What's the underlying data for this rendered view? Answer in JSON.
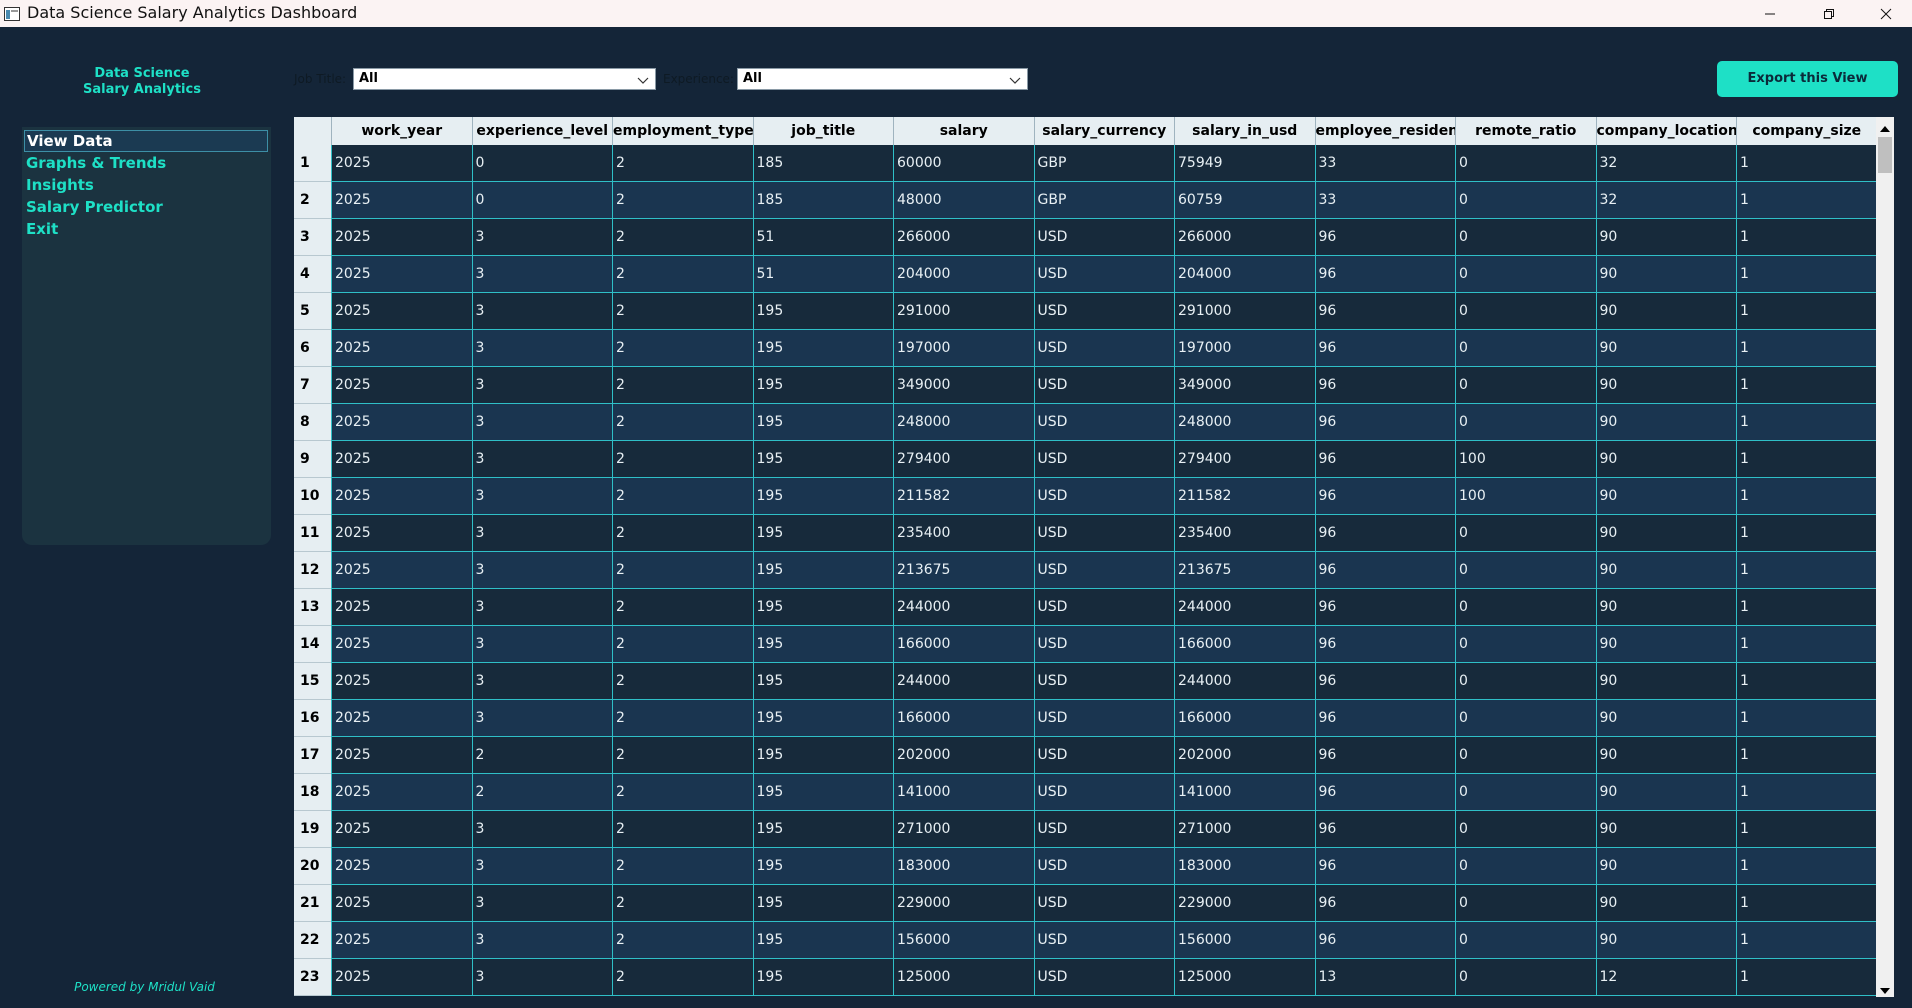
{
  "window": {
    "title": "Data Science Salary Analytics Dashboard"
  },
  "sidebar": {
    "brand_line1": "Data Science",
    "brand_line2": "Salary Analytics",
    "items": [
      {
        "label": "View Data",
        "active": true
      },
      {
        "label": "Graphs & Trends",
        "active": false
      },
      {
        "label": "Insights",
        "active": false
      },
      {
        "label": "Salary Predictor",
        "active": false
      },
      {
        "label": "Exit",
        "active": false
      }
    ],
    "footer": "Powered by Mridul Vaid"
  },
  "filters": {
    "job_title_label": "Job Title:",
    "job_title_value": "All",
    "experience_label": "Experience:",
    "experience_value": "All"
  },
  "toolbar": {
    "export_label": "Export this View"
  },
  "table": {
    "columns": [
      "work_year",
      "experience_level",
      "employment_type",
      "job_title",
      "salary",
      "salary_currency",
      "salary_in_usd",
      "employee_residence",
      "remote_ratio",
      "company_location",
      "company_size"
    ],
    "row_numbers": [
      "1",
      "2",
      "3",
      "4",
      "5",
      "6",
      "7",
      "8",
      "9",
      "10",
      "11",
      "12",
      "13",
      "14",
      "15",
      "16",
      "17",
      "18",
      "19",
      "20",
      "21",
      "22",
      "23"
    ],
    "rows": [
      [
        "2025",
        "0",
        "2",
        "185",
        "60000",
        "GBP",
        "75949",
        "33",
        "0",
        "32",
        "1"
      ],
      [
        "2025",
        "0",
        "2",
        "185",
        "48000",
        "GBP",
        "60759",
        "33",
        "0",
        "32",
        "1"
      ],
      [
        "2025",
        "3",
        "2",
        "51",
        "266000",
        "USD",
        "266000",
        "96",
        "0",
        "90",
        "1"
      ],
      [
        "2025",
        "3",
        "2",
        "51",
        "204000",
        "USD",
        "204000",
        "96",
        "0",
        "90",
        "1"
      ],
      [
        "2025",
        "3",
        "2",
        "195",
        "291000",
        "USD",
        "291000",
        "96",
        "0",
        "90",
        "1"
      ],
      [
        "2025",
        "3",
        "2",
        "195",
        "197000",
        "USD",
        "197000",
        "96",
        "0",
        "90",
        "1"
      ],
      [
        "2025",
        "3",
        "2",
        "195",
        "349000",
        "USD",
        "349000",
        "96",
        "0",
        "90",
        "1"
      ],
      [
        "2025",
        "3",
        "2",
        "195",
        "248000",
        "USD",
        "248000",
        "96",
        "0",
        "90",
        "1"
      ],
      [
        "2025",
        "3",
        "2",
        "195",
        "279400",
        "USD",
        "279400",
        "96",
        "100",
        "90",
        "1"
      ],
      [
        "2025",
        "3",
        "2",
        "195",
        "211582",
        "USD",
        "211582",
        "96",
        "100",
        "90",
        "1"
      ],
      [
        "2025",
        "3",
        "2",
        "195",
        "235400",
        "USD",
        "235400",
        "96",
        "0",
        "90",
        "1"
      ],
      [
        "2025",
        "3",
        "2",
        "195",
        "213675",
        "USD",
        "213675",
        "96",
        "0",
        "90",
        "1"
      ],
      [
        "2025",
        "3",
        "2",
        "195",
        "244000",
        "USD",
        "244000",
        "96",
        "0",
        "90",
        "1"
      ],
      [
        "2025",
        "3",
        "2",
        "195",
        "166000",
        "USD",
        "166000",
        "96",
        "0",
        "90",
        "1"
      ],
      [
        "2025",
        "3",
        "2",
        "195",
        "244000",
        "USD",
        "244000",
        "96",
        "0",
        "90",
        "1"
      ],
      [
        "2025",
        "3",
        "2",
        "195",
        "166000",
        "USD",
        "166000",
        "96",
        "0",
        "90",
        "1"
      ],
      [
        "2025",
        "2",
        "2",
        "195",
        "202000",
        "USD",
        "202000",
        "96",
        "0",
        "90",
        "1"
      ],
      [
        "2025",
        "2",
        "2",
        "195",
        "141000",
        "USD",
        "141000",
        "96",
        "0",
        "90",
        "1"
      ],
      [
        "2025",
        "3",
        "2",
        "195",
        "271000",
        "USD",
        "271000",
        "96",
        "0",
        "90",
        "1"
      ],
      [
        "2025",
        "3",
        "2",
        "195",
        "183000",
        "USD",
        "183000",
        "96",
        "0",
        "90",
        "1"
      ],
      [
        "2025",
        "3",
        "2",
        "195",
        "229000",
        "USD",
        "229000",
        "96",
        "0",
        "90",
        "1"
      ],
      [
        "2025",
        "3",
        "2",
        "195",
        "156000",
        "USD",
        "156000",
        "96",
        "0",
        "90",
        "1"
      ],
      [
        "2025",
        "3",
        "2",
        "195",
        "125000",
        "USD",
        "125000",
        "13",
        "0",
        "12",
        "1"
      ]
    ]
  },
  "colors": {
    "accent": "#1ee0c6",
    "background": "#142538",
    "grid": "#2fbfc7"
  }
}
